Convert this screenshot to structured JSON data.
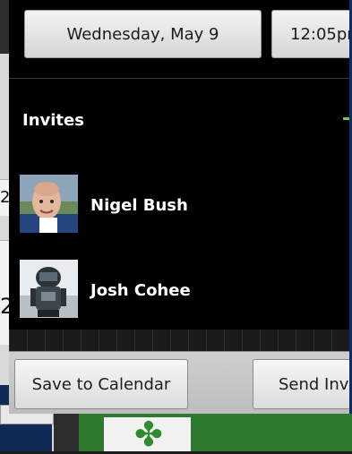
{
  "dialog": {
    "date_button_label": "Wednesday, May 9",
    "time_button_label": "12:05pm",
    "invites_title": "Invites",
    "invites": [
      {
        "name": "Nigel Bush",
        "avatar": "person-photo"
      },
      {
        "name": "Josh Cohee",
        "avatar": "robot-photo"
      }
    ],
    "save_button_label": "Save to Calendar",
    "send_button_label": "Send Invite"
  },
  "background": {
    "left_numbers": [
      "2",
      "2"
    ],
    "glyph": "clover-icon"
  },
  "colors": {
    "dialog_bg": "#000000",
    "accent_green": "#7ec83a",
    "background_green": "#2f7a2f"
  }
}
